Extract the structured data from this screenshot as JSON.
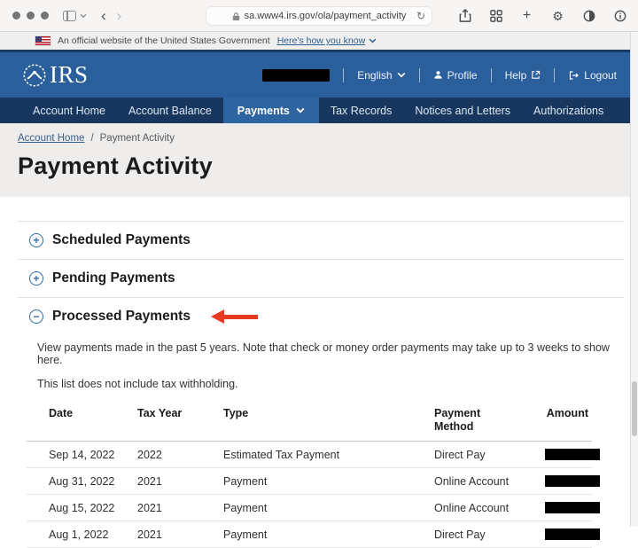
{
  "browser": {
    "url": "sa.www4.irs.gov/ola/payment_activity"
  },
  "banner": {
    "text": "An official website of the United States Government",
    "link": "Here's how you know"
  },
  "header": {
    "logo_text": "IRS",
    "language": "English",
    "profile_label": "Profile",
    "help_label": "Help",
    "logout_label": "Logout"
  },
  "nav": {
    "items": [
      {
        "label": "Account Home"
      },
      {
        "label": "Account Balance"
      },
      {
        "label": "Payments"
      },
      {
        "label": "Tax Records"
      },
      {
        "label": "Notices and Letters"
      },
      {
        "label": "Authorizations"
      }
    ]
  },
  "breadcrumb": {
    "link_label": "Account Home",
    "separator": "/",
    "current": "Payment Activity"
  },
  "page": {
    "title": "Payment Activity"
  },
  "sections": [
    {
      "label": "Scheduled Payments",
      "state": "collapsed",
      "icon": "plus-circle-icon"
    },
    {
      "label": "Pending Payments",
      "state": "collapsed",
      "icon": "plus-circle-icon"
    },
    {
      "label": "Processed Payments",
      "state": "expanded",
      "icon": "minus-circle-icon"
    }
  ],
  "processed": {
    "description": "View payments made in the past 5 years. Note that check or money order payments may take up to 3 weeks to show here.",
    "note": "This list does not include tax withholding.",
    "table": {
      "headers": [
        "Date",
        "Tax Year",
        "Type",
        "Payment Method",
        "Amount"
      ],
      "rows": [
        {
          "date": "Sep 14, 2022",
          "tax_year": "2022",
          "type": "Estimated Tax Payment",
          "method": "Direct Pay",
          "amount": "[redacted]"
        },
        {
          "date": "Aug 31, 2022",
          "tax_year": "2021",
          "type": "Payment",
          "method": "Online Account",
          "amount": "[redacted]"
        },
        {
          "date": "Aug 15, 2022",
          "tax_year": "2021",
          "type": "Payment",
          "method": "Online Account",
          "amount": "[redacted]"
        },
        {
          "date": "Aug 1, 2022",
          "tax_year": "2021",
          "type": "Payment",
          "method": "Direct Pay",
          "amount": "[redacted]"
        }
      ]
    }
  },
  "colors": {
    "header_blue": "#2a5f9c",
    "nav_navy": "#17375f",
    "active_tab_blue": "#2e649f",
    "link_blue": "#2c608f",
    "accordion_icon_blue": "#2f6da8",
    "annotation_arrow_red": "#e63b1e",
    "redaction_black": "#000000"
  }
}
